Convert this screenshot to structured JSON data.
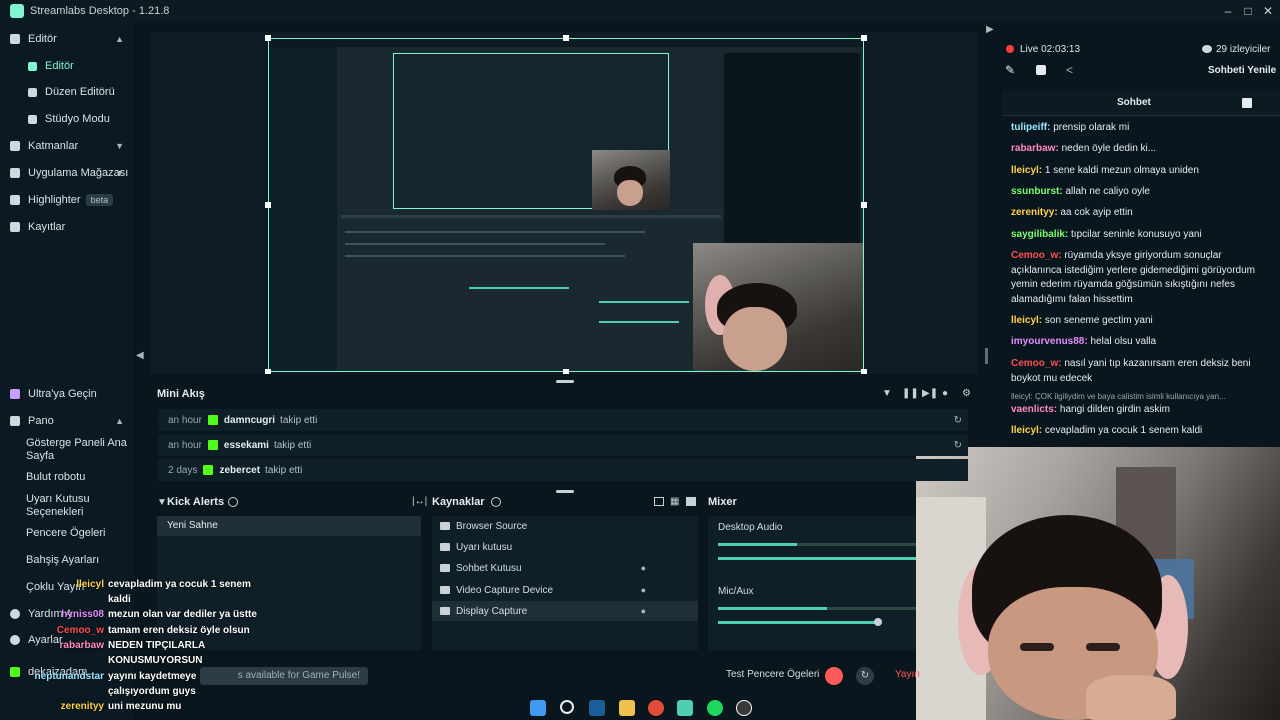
{
  "app": {
    "title": "Streamlabs Desktop - 1.21.8"
  },
  "sidebar": {
    "items": [
      {
        "label": "Editör",
        "icon": "editor-icon"
      },
      {
        "label": "Editör",
        "icon": "editor-sub-icon"
      },
      {
        "label": "Düzen Editörü",
        "icon": "layout-editor-icon"
      },
      {
        "label": "Stüdyo Modu",
        "icon": "studio-mode-icon"
      },
      {
        "label": "Katmanlar",
        "icon": "layers-icon"
      },
      {
        "label": "Uygulama Mağazası",
        "icon": "app-store-icon"
      },
      {
        "label": "Highlighter",
        "icon": "highlighter-icon",
        "badge": "beta"
      },
      {
        "label": "Kayıtlar",
        "icon": "recordings-icon"
      }
    ],
    "bottom": [
      {
        "label": "Ultra'ya Geçin",
        "icon": "ultra-icon"
      },
      {
        "label": "Pano",
        "icon": "dashboard-icon"
      },
      {
        "label": "Gösterge Paneli Ana Sayfa"
      },
      {
        "label": "Bulut robotu"
      },
      {
        "label": "Uyarı Kutusu Seçenekleri"
      },
      {
        "label": "Pencere Ögeleri"
      },
      {
        "label": "Bahşiş Ayarları"
      },
      {
        "label": "Çoklu Yayın"
      },
      {
        "label": "Yardım A"
      },
      {
        "label": "Ayarlar"
      },
      {
        "label": "dekaizadam"
      }
    ]
  },
  "live": {
    "label": "Live 02:03:13",
    "viewers": "29 izleyiciler",
    "refresh": "Sohbeti Yenile"
  },
  "chat": {
    "title": "Sohbet",
    "messages": [
      {
        "user": "tulipeiff:",
        "text": "prensip olarak mi",
        "color": "#9be7ff"
      },
      {
        "user": "rabarbaw:",
        "text": "neden öyle dedin ki...",
        "color": "#ff8ac0"
      },
      {
        "user": "lleicyl:",
        "text": "1 sene kaldi mezun olmaya uniden",
        "color": "#ffd24a"
      },
      {
        "user": "ssunburst:",
        "text": "allah ne caliyo oyle",
        "color": "#7cff6e"
      },
      {
        "user": "zerenityy:",
        "text": "aa cok ayip ettin",
        "color": "#ffd24a"
      },
      {
        "user": "saygilibalik:",
        "text": "tıpcilar seninle konusuyo yani",
        "color": "#7cff6e"
      },
      {
        "user": "Cemoo_w:",
        "text": "rüyamda yksye giriyordum sonuçlar açıklanınca istediğim yerlere gidemediğimi görüyordum yemin ederim rüyamda göğsümün sıkıştığını nefes alamadığımı falan hissettim",
        "color": "#ff4d4d"
      },
      {
        "user": "lleicyl:",
        "text": "son seneme gectim yani",
        "color": "#ffd24a"
      },
      {
        "user": "imyourvenus88:",
        "text": "helal olsu valla",
        "color": "#e48bff"
      },
      {
        "user": "Cemoo_w:",
        "text": "nasıl yani tıp kazanırsam eren deksiz beni boykot mu edecek",
        "color": "#ff4d4d"
      },
      {
        "user": "",
        "text": "lleicyl: ÇOK ilgiliydim ve baya calistim isimli kullanıcıya yan...",
        "color": "#9aa7ad"
      },
      {
        "user": "vaenlicts:",
        "text": "hangi dilden girdin askim",
        "color": "#ff8ac0"
      },
      {
        "user": "lleicyl:",
        "text": "cevapladim ya cocuk 1 senem kaldi",
        "color": "#ffd24a"
      }
    ]
  },
  "mini_feed": {
    "title": "Mini Akış",
    "rows": [
      {
        "time": "an hour",
        "name": "damncugri",
        "action": "takip etti"
      },
      {
        "time": "an hour",
        "name": "essekami",
        "action": "takip etti"
      },
      {
        "time": "2 days",
        "name": "zebercet",
        "action": "takip etti"
      }
    ]
  },
  "scenes": {
    "title": "Kick Alerts",
    "items": [
      "Yeni Sahne"
    ]
  },
  "sources": {
    "title": "Kaynaklar",
    "items": [
      {
        "label": "Browser Source",
        "locked": false
      },
      {
        "label": "Uyarı kutusu",
        "locked": false
      },
      {
        "label": "Sohbet Kutusu",
        "locked": true
      },
      {
        "label": "Video Capture Device",
        "locked": true
      },
      {
        "label": "Display Capture",
        "locked": true
      }
    ]
  },
  "mixer": {
    "title": "Mixer",
    "channels": [
      {
        "name": "Desktop Audio",
        "level": 0.4
      },
      {
        "name": "Mic/Aux",
        "level": 0.55
      }
    ]
  },
  "footer": {
    "test_label": "Test Pencere Ögeleri",
    "go_live": "Yayın",
    "notice": "s available for Game Pulse!"
  },
  "overlay_chat": [
    {
      "user": "lleicyl",
      "text": "cevapladim ya cocuk 1 senem kaldi",
      "color": "#ffd24a"
    },
    {
      "user": "hyniss08",
      "text": "mezun olan var dediler ya üstte",
      "color": "#e48bff"
    },
    {
      "user": "Cemoo_w",
      "text": "tamam eren deksiz öyle olsun",
      "color": "#ff4d4d"
    },
    {
      "user": "rabarbaw",
      "text": "NEDEN TIPÇILARLA KONUSMUYORSUN",
      "color": "#ff8ac0"
    },
    {
      "user": "neptunandstar",
      "text": "yayını kaydetmeye çalışıyordum guys",
      "color": "#9be7ff"
    },
    {
      "user": "zerenityy",
      "text": "uni mezunu mu",
      "color": "#ffd24a"
    }
  ]
}
